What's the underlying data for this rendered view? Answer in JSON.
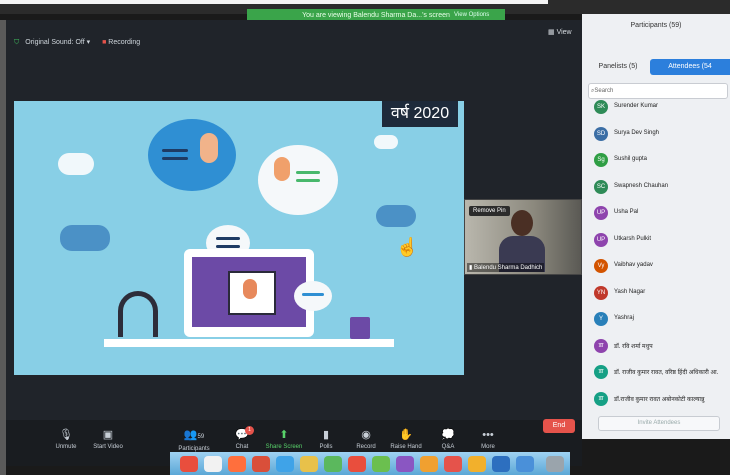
{
  "window": {
    "top_banner": "You are viewing Balendu Sharma Da...'s screen",
    "view_options_top": "View Options"
  },
  "meeting_status": {
    "original_sound": "Original Sound: Off",
    "recording": "Recording",
    "view": "View"
  },
  "slide": {
    "year_text": "वर्ष 2020"
  },
  "speaker_video": {
    "remove_pin": "Remove Pin",
    "name": "Balendu Sharma Dadhich"
  },
  "participants_panel": {
    "title": "Participants (59)",
    "tab_panelists": "Panelists (5)",
    "tab_attendees": "Attendees (54",
    "search_placeholder": "Search",
    "items": [
      {
        "initials": "SK",
        "name": "Surender Kumar",
        "color": "#2e8b57"
      },
      {
        "initials": "SD",
        "name": "Surya Dev Singh",
        "color": "#3b6ea5"
      },
      {
        "initials": "Sg",
        "name": "Sushil gupta",
        "color": "#2f9e44"
      },
      {
        "initials": "SC",
        "name": "Swapnesh Chauhan",
        "color": "#2e8b57"
      },
      {
        "initials": "UP",
        "name": "Usha Pal",
        "color": "#8e44ad"
      },
      {
        "initials": "UP",
        "name": "Utkarsh Pulkit",
        "color": "#8e44ad"
      },
      {
        "initials": "Vy",
        "name": "Vaibhav yadav",
        "color": "#d35400"
      },
      {
        "initials": "YN",
        "name": "Yash Nagar",
        "color": "#c0392b"
      },
      {
        "initials": "Y",
        "name": "Yashraj",
        "color": "#2980b9"
      },
      {
        "initials": "डा",
        "name": "डॉ. रवि शर्मा मधुप",
        "color": "#8e44ad"
      },
      {
        "initials": "डा",
        "name": "डॉ. राजीव कुमार रावत, वरिष्ठ हिंदी अधिकारी आ.",
        "color": "#16a085"
      },
      {
        "initials": "डा",
        "name": "डॉ.राजीव कुमार रावत अबोनकोटी काल्यान्नु",
        "color": "#16a085"
      }
    ],
    "invite": "Invite Attendees"
  },
  "toolbar": {
    "unmute": "Unmute",
    "start_video": "Start Video",
    "participants": "Participants",
    "participants_count": "59",
    "chat": "Chat",
    "chat_badge": "1",
    "share_screen": "Share Screen",
    "polls": "Polls",
    "record": "Record",
    "raise_hand": "Raise Hand",
    "qa": "Q&A",
    "more": "More",
    "end": "End"
  },
  "colors": {
    "accent": "#2c7fdc",
    "share_green": "#58d26a",
    "end_red": "#e5534b",
    "slide_bg": "#88cfe6"
  }
}
